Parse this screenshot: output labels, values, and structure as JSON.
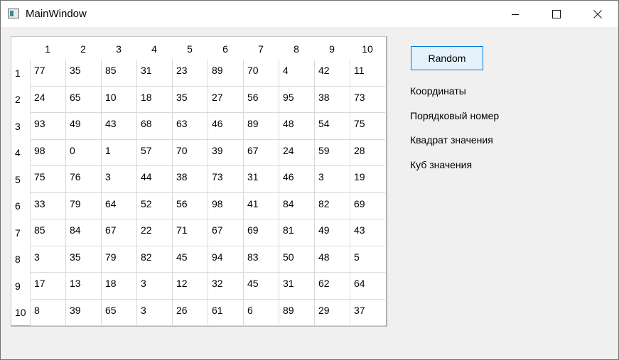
{
  "window": {
    "title": "MainWindow"
  },
  "grid": {
    "columns": [
      "1",
      "2",
      "3",
      "4",
      "5",
      "6",
      "7",
      "8",
      "9",
      "10"
    ],
    "rows": [
      {
        "label": "1",
        "cells": [
          "77",
          "35",
          "85",
          "31",
          "23",
          "89",
          "70",
          "4",
          "42",
          "11"
        ]
      },
      {
        "label": "2",
        "cells": [
          "24",
          "65",
          "10",
          "18",
          "35",
          "27",
          "56",
          "95",
          "38",
          "73"
        ]
      },
      {
        "label": "3",
        "cells": [
          "93",
          "49",
          "43",
          "68",
          "63",
          "46",
          "89",
          "48",
          "54",
          "75"
        ]
      },
      {
        "label": "4",
        "cells": [
          "98",
          "0",
          "1",
          "57",
          "70",
          "39",
          "67",
          "24",
          "59",
          "28"
        ]
      },
      {
        "label": "5",
        "cells": [
          "75",
          "76",
          "3",
          "44",
          "38",
          "73",
          "31",
          "46",
          "3",
          "19"
        ]
      },
      {
        "label": "6",
        "cells": [
          "33",
          "79",
          "64",
          "52",
          "56",
          "98",
          "41",
          "84",
          "82",
          "69"
        ]
      },
      {
        "label": "7",
        "cells": [
          "85",
          "84",
          "67",
          "22",
          "71",
          "67",
          "69",
          "81",
          "49",
          "43"
        ]
      },
      {
        "label": "8",
        "cells": [
          "3",
          "35",
          "79",
          "82",
          "45",
          "94",
          "83",
          "50",
          "48",
          "5"
        ]
      },
      {
        "label": "9",
        "cells": [
          "17",
          "13",
          "18",
          "3",
          "12",
          "32",
          "45",
          "31",
          "62",
          "64"
        ]
      },
      {
        "label": "10",
        "cells": [
          "8",
          "39",
          "65",
          "3",
          "26",
          "61",
          "6",
          "89",
          "29",
          "37"
        ]
      }
    ]
  },
  "panel": {
    "random_label": "Random",
    "coordinates_label": "Координаты",
    "ordinal_label": "Порядковый номер",
    "square_label": "Квадрат значения",
    "cube_label": "Куб значения"
  }
}
